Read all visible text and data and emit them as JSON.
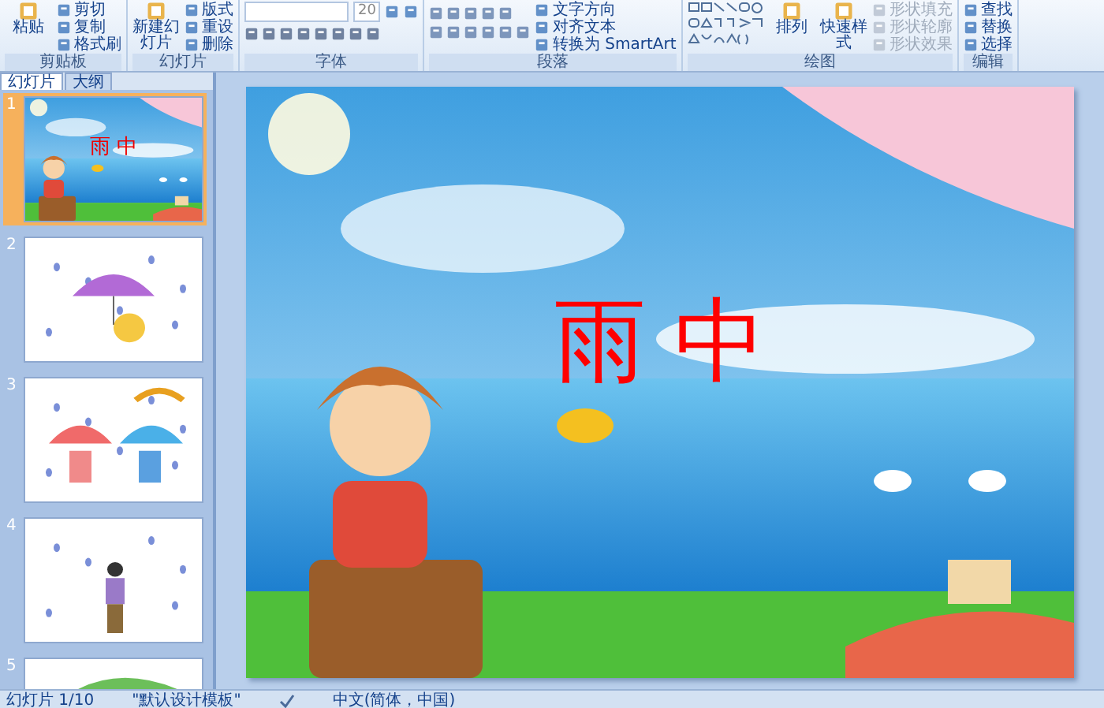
{
  "ribbon": {
    "groups": [
      {
        "kind": "clipboard",
        "label": "剪贴板",
        "large": [
          "粘贴"
        ],
        "small": [
          {
            "label": "剪切",
            "disabled": false
          },
          {
            "label": "复制",
            "disabled": false
          },
          {
            "label": "格式刷",
            "disabled": false
          }
        ]
      },
      {
        "kind": "slides",
        "label": "幻灯片",
        "large": [
          "新建幻灯片"
        ],
        "small": [
          {
            "label": "版式",
            "disabled": false
          },
          {
            "label": "重设",
            "disabled": false
          },
          {
            "label": "删除",
            "disabled": false
          }
        ]
      },
      {
        "kind": "font",
        "label": "字体",
        "font_size": "20"
      },
      {
        "kind": "paragraph",
        "label": "段落",
        "small": [
          {
            "label": "文字方向",
            "disabled": false
          },
          {
            "label": "对齐文本",
            "disabled": false
          },
          {
            "label": "转换为 SmartArt",
            "disabled": false
          }
        ]
      },
      {
        "kind": "drawing",
        "label": "绘图",
        "large": [
          "排列",
          "快速样式"
        ],
        "small": [
          {
            "label": "形状填充",
            "disabled": true
          },
          {
            "label": "形状轮廓",
            "disabled": true
          },
          {
            "label": "形状效果",
            "disabled": true
          }
        ]
      },
      {
        "kind": "editing",
        "label": "编辑",
        "small": [
          {
            "label": "查找",
            "disabled": false
          },
          {
            "label": "替换",
            "disabled": false
          },
          {
            "label": "选择",
            "disabled": false
          }
        ]
      }
    ]
  },
  "pane": {
    "tabs": [
      {
        "label": "幻灯片",
        "selected": true
      },
      {
        "label": "大纲",
        "selected": false
      }
    ],
    "slides": [
      {
        "number": "1",
        "selected": true,
        "kind": "title",
        "title": "雨 中"
      },
      {
        "number": "2",
        "selected": false,
        "kind": "umbrella"
      },
      {
        "number": "3",
        "selected": false,
        "kind": "children"
      },
      {
        "number": "4",
        "selected": false,
        "kind": "man"
      },
      {
        "number": "5",
        "selected": false,
        "kind": "leaf"
      }
    ]
  },
  "slide": {
    "title": "雨 中"
  },
  "status_bar": [
    "幻灯片 1/10",
    "\"默认设计模板\"",
    "中文(简体，中国)"
  ]
}
